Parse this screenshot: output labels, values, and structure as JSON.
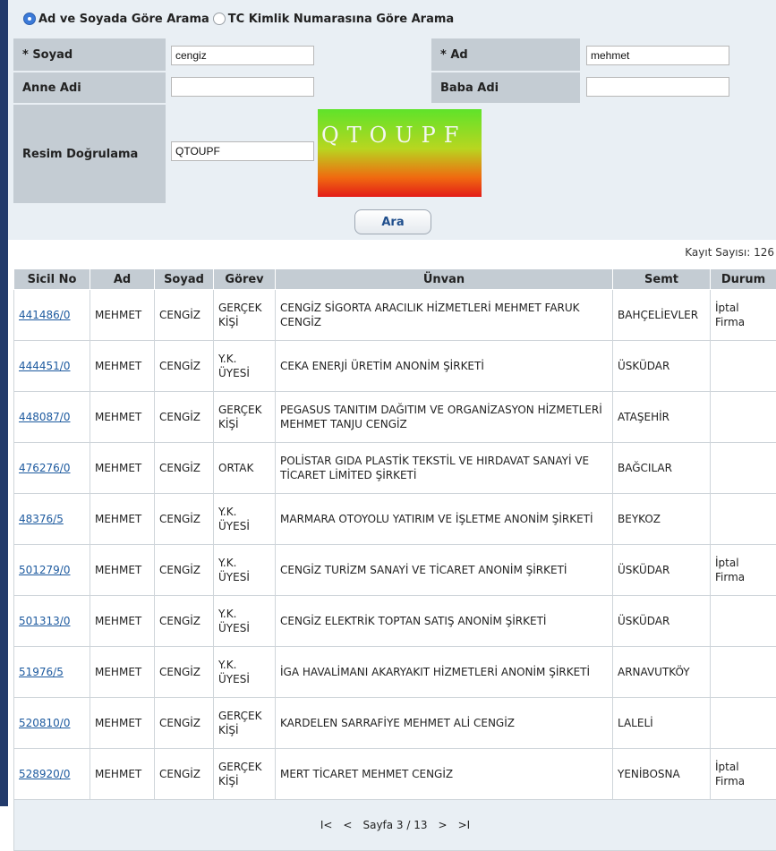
{
  "search_mode": {
    "option_name": "Ad ve Soyada Göre Arama",
    "option_tc": "TC Kimlik Numarasına Göre Arama",
    "selected": "name"
  },
  "form": {
    "soyad_label": "* Soyad",
    "soyad_value": "cengiz",
    "ad_label": "* Ad",
    "ad_value": "mehmet",
    "anne_label": "Anne Adi",
    "anne_value": "",
    "baba_label": "Baba Adi",
    "baba_value": "",
    "captcha_label": "Resim Doğrulama",
    "captcha_value": "QTOUPF",
    "captcha_image_text": "QTOUPF",
    "submit_label": "Ara"
  },
  "kayit_sayisi": "Kayıt Sayısı: 126",
  "table": {
    "headers": [
      "Sicil No",
      "Ad",
      "Soyad",
      "Görev",
      "Ünvan",
      "Semt",
      "Durum"
    ],
    "rows": [
      {
        "sicil": "441486/0",
        "ad": "MEHMET",
        "soyad": "CENGİZ",
        "gorev": "GERÇEK KİŞİ",
        "unvan": "CENGİZ SİGORTA ARACILIK HİZMETLERİ MEHMET FARUK CENGİZ",
        "semt": "BAHÇELİEVLER",
        "durum": "İptal Firma"
      },
      {
        "sicil": "444451/0",
        "ad": "MEHMET",
        "soyad": "CENGİZ",
        "gorev": "Y.K. ÜYESİ",
        "unvan": "CEKA ENERJİ ÜRETİM ANONİM ŞİRKETİ",
        "semt": "ÜSKÜDAR",
        "durum": ""
      },
      {
        "sicil": "448087/0",
        "ad": "MEHMET",
        "soyad": "CENGİZ",
        "gorev": "GERÇEK KİŞİ",
        "unvan": "PEGASUS TANITIM DAĞITIM VE ORGANİZASYON HİZMETLERİ MEHMET TANJU CENGİZ",
        "semt": "ATAŞEHİR",
        "durum": ""
      },
      {
        "sicil": "476276/0",
        "ad": "MEHMET",
        "soyad": "CENGİZ",
        "gorev": "ORTAK",
        "unvan": "POLİSTAR GIDA PLASTİK TEKSTİL VE HIRDAVAT SANAYİ VE TİCARET LİMİTED ŞİRKETİ",
        "semt": "BAĞCILAR",
        "durum": ""
      },
      {
        "sicil": "48376/5",
        "ad": "MEHMET",
        "soyad": "CENGİZ",
        "gorev": "Y.K. ÜYESİ",
        "unvan": "MARMARA OTOYOLU YATIRIM VE İŞLETME ANONİM ŞİRKETİ",
        "semt": "BEYKOZ",
        "durum": ""
      },
      {
        "sicil": "501279/0",
        "ad": "MEHMET",
        "soyad": "CENGİZ",
        "gorev": "Y.K. ÜYESİ",
        "unvan": "CENGİZ TURİZM SANAYİ VE TİCARET ANONİM ŞİRKETİ",
        "semt": "ÜSKÜDAR",
        "durum": "İptal Firma"
      },
      {
        "sicil": "501313/0",
        "ad": "MEHMET",
        "soyad": "CENGİZ",
        "gorev": "Y.K. ÜYESİ",
        "unvan": "CENGİZ ELEKTRİK TOPTAN SATIŞ ANONİM ŞİRKETİ",
        "semt": "ÜSKÜDAR",
        "durum": ""
      },
      {
        "sicil": "51976/5",
        "ad": "MEHMET",
        "soyad": "CENGİZ",
        "gorev": "Y.K. ÜYESİ",
        "unvan": "İGA HAVALİMANI AKARYAKIT HİZMETLERİ ANONİM ŞİRKETİ",
        "semt": "ARNAVUTKÖY",
        "durum": ""
      },
      {
        "sicil": "520810/0",
        "ad": "MEHMET",
        "soyad": "CENGİZ",
        "gorev": "GERÇEK KİŞİ",
        "unvan": "KARDELEN SARRAFİYE MEHMET ALİ CENGİZ",
        "semt": "LALELİ",
        "durum": ""
      },
      {
        "sicil": "528920/0",
        "ad": "MEHMET",
        "soyad": "CENGİZ",
        "gorev": "GERÇEK KİŞİ",
        "unvan": "MERT TİCARET MEHMET CENGİZ",
        "semt": "YENİBOSNA",
        "durum": "İptal Firma"
      }
    ]
  },
  "pager": {
    "first": "I<",
    "prev": "<",
    "label": "Sayfa 3 / 13",
    "next": ">",
    "last": ">I"
  }
}
